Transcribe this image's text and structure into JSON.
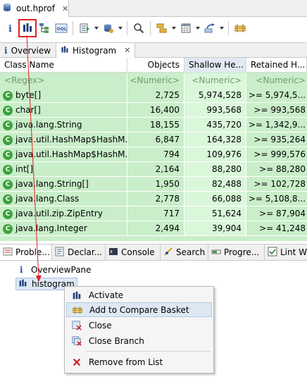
{
  "editor": {
    "title": "out.hprof",
    "close": "✕"
  },
  "toolbar": {
    "buttons": [
      "info-icon",
      "histogram-icon",
      "dominator-tree-icon",
      "oql-icon",
      "run-query-icon",
      "heap-dump-overview-icon",
      "search-icon",
      "group-icon",
      "calculate-icon",
      "export-icon",
      "compare-icon"
    ]
  },
  "view_tabs": [
    {
      "icon": "i",
      "label": "Overview"
    },
    {
      "icon": "bars",
      "label": "Histogram",
      "close": "✕"
    }
  ],
  "table": {
    "columns": [
      "Class Name",
      "Objects",
      "Shallow He...",
      "Retained H..."
    ],
    "filter": [
      "<Regex>",
      "<Numeric>",
      "<Numeric>",
      "<Numeric>"
    ],
    "rows": [
      {
        "name": "byte[]",
        "objects": "2,725",
        "shallow": "5,974,528",
        "retained": ">= 5,974,5..."
      },
      {
        "name": "char[]",
        "objects": "16,400",
        "shallow": "993,568",
        "retained": ">= 993,568"
      },
      {
        "name": "java.lang.String",
        "objects": "18,155",
        "shallow": "435,720",
        "retained": ">= 1,342,9..."
      },
      {
        "name": "java.util.HashMap$HashM...",
        "objects": "6,847",
        "shallow": "164,328",
        "retained": ">= 935,264"
      },
      {
        "name": "java.util.HashMap$HashM...",
        "objects": "794",
        "shallow": "109,976",
        "retained": ">= 999,576"
      },
      {
        "name": "int[]",
        "objects": "2,164",
        "shallow": "88,280",
        "retained": ">= 88,280"
      },
      {
        "name": "java.lang.String[]",
        "objects": "1,950",
        "shallow": "82,488",
        "retained": ">= 102,728"
      },
      {
        "name": "java.lang.Class",
        "objects": "2,778",
        "shallow": "66,088",
        "retained": ">= 5,108,8..."
      },
      {
        "name": "java.util.zip.ZipEntry",
        "objects": "717",
        "shallow": "51,624",
        "retained": ">= 87,904"
      },
      {
        "name": "java.lang.Integer",
        "objects": "2,494",
        "shallow": "39,904",
        "retained": ">= 41,248"
      }
    ]
  },
  "bottom_tabs": [
    "Proble...",
    "Declar...",
    "Console",
    "Search",
    "Progre...",
    "Lint W..."
  ],
  "navigator": [
    {
      "icon": "i",
      "label": "OverviewPane"
    },
    {
      "icon": "bars",
      "label": "histogram"
    }
  ],
  "context_menu": {
    "items": [
      "Activate",
      "Add to Compare Basket",
      "Close",
      "Close Branch",
      "Remove from List"
    ]
  },
  "colors": {
    "green_row": "#c9eec9",
    "selection": "#dce8f5",
    "annotation": "#e02020"
  }
}
